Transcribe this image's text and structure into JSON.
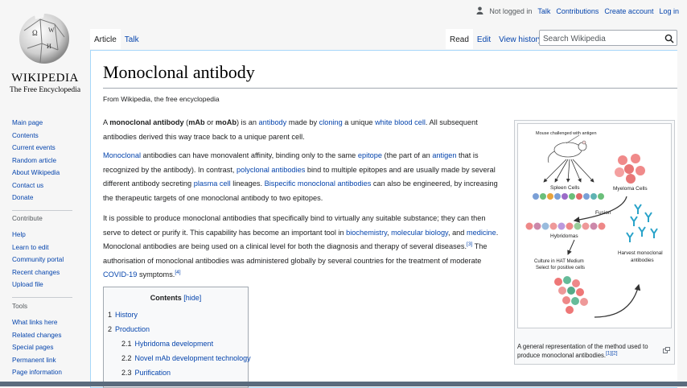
{
  "logo": {
    "title": "WIKIPEDIA",
    "tagline": "The Free Encyclopedia"
  },
  "personal": {
    "status": "Not logged in",
    "talk": "Talk",
    "contributions": "Contributions",
    "create_account": "Create account",
    "login": "Log in"
  },
  "tabs": {
    "namespaces": [
      "Article",
      "Talk"
    ],
    "views": [
      "Read",
      "Edit",
      "View history"
    ]
  },
  "search": {
    "placeholder": "Search Wikipedia"
  },
  "article": {
    "title": "Monoclonal antibody",
    "site_sub": "From Wikipedia, the free encyclopedia",
    "p1": {
      "t1": "A ",
      "b1": "monoclonal antibody",
      "t2": " (",
      "b2": "mAb",
      "t3": " or ",
      "b3": "moAb",
      "t4": ") is an ",
      "l1": "antibody",
      "t5": " made by ",
      "l2": "cloning",
      "t6": " a unique ",
      "l3": "white blood cell",
      "t7": ". All subsequent antibodies derived this way trace back to a unique parent cell."
    },
    "p2": {
      "l1": "Monoclonal",
      "t1": " antibodies can have monovalent affinity, binding only to the same ",
      "l2": "epitope",
      "t2": " (the part of an ",
      "l3": "antigen",
      "t3": " that is recognized by the antibody). In contrast, ",
      "l4": "polyclonal antibodies",
      "t4": " bind to multiple epitopes and are usually made by several different antibody secreting ",
      "l5": "plasma cell",
      "t5": " lineages. ",
      "l6": "Bispecific monoclonal antibodies",
      "t6": " can also be engineered, by increasing the therapeutic targets of one monoclonal antibody to two epitopes."
    },
    "p3": {
      "t1": "It is possible to produce monoclonal antibodies that specifically bind to virtually any suitable substance; they can then serve to detect or purify it. This capability has become an important tool in ",
      "l1": "biochemistry",
      "t2": ", ",
      "l2": "molecular biology",
      "t3": ", and ",
      "l3": "medicine",
      "t4": ". Monoclonal antibodies are being used on a clinical level for both the diagnosis and therapy of several diseases.",
      "r1": "[3]",
      "t5": " The authorisation of monoclonal antibodies was administered globally by several countries for the treatment of moderate ",
      "l4": "COVID-19",
      "t6": " symptoms.",
      "r2": "[4]"
    }
  },
  "toc": {
    "title": "Contents",
    "hide": "[hide]",
    "items": [
      {
        "num": "1",
        "label": "History"
      },
      {
        "num": "2",
        "label": "Production"
      },
      {
        "num": "2.1",
        "label": "Hybridoma development"
      },
      {
        "num": "2.2",
        "label": "Novel mAb development technology"
      },
      {
        "num": "2.3",
        "label": "Purification"
      }
    ]
  },
  "figure": {
    "labels": {
      "mouse": "Mouse challenged with antigen",
      "spleen": "Spleen Cells",
      "myeloma": "Myeloma Cells",
      "fusion": "Fusion",
      "hybridomas": "Hybridomas",
      "culture1": "Culture in HAT Medium",
      "culture2": "Select for positive cells",
      "harvest1": "Harvest monoclonal",
      "harvest2": "antibodies"
    },
    "caption1": "A general representation of the method used to produce monoclonal antibodies.",
    "caption_ref": "[1][2]"
  },
  "sidebar": {
    "nav": [
      "Main page",
      "Contents",
      "Current events",
      "Random article",
      "About Wikipedia",
      "Contact us",
      "Donate"
    ],
    "contribute_heading": "Contribute",
    "contribute": [
      "Help",
      "Learn to edit",
      "Community portal",
      "Recent changes",
      "Upload file"
    ],
    "tools_heading": "Tools",
    "tools": [
      "What links here",
      "Related changes",
      "Special pages",
      "Permanent link",
      "Page information"
    ]
  },
  "colors": {
    "link": "#0645ad",
    "border": "#a7d7f9",
    "text": "#202122"
  }
}
